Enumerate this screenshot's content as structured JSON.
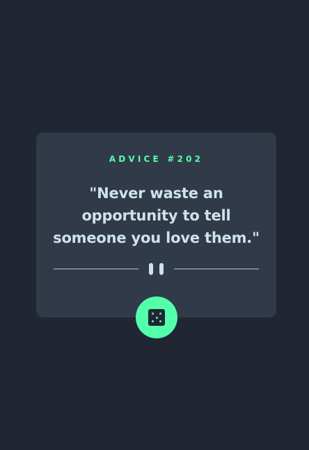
{
  "advice": {
    "label": "ADVICE #202",
    "quote": "\"Never waste an opportunity to tell someone you love them.\""
  },
  "icons": {
    "divider": "pause-icon",
    "generate": "dice-icon"
  },
  "colors": {
    "background": "#202733",
    "card": "#313a48",
    "accent": "#53ffaa",
    "text": "#cee3e9"
  }
}
